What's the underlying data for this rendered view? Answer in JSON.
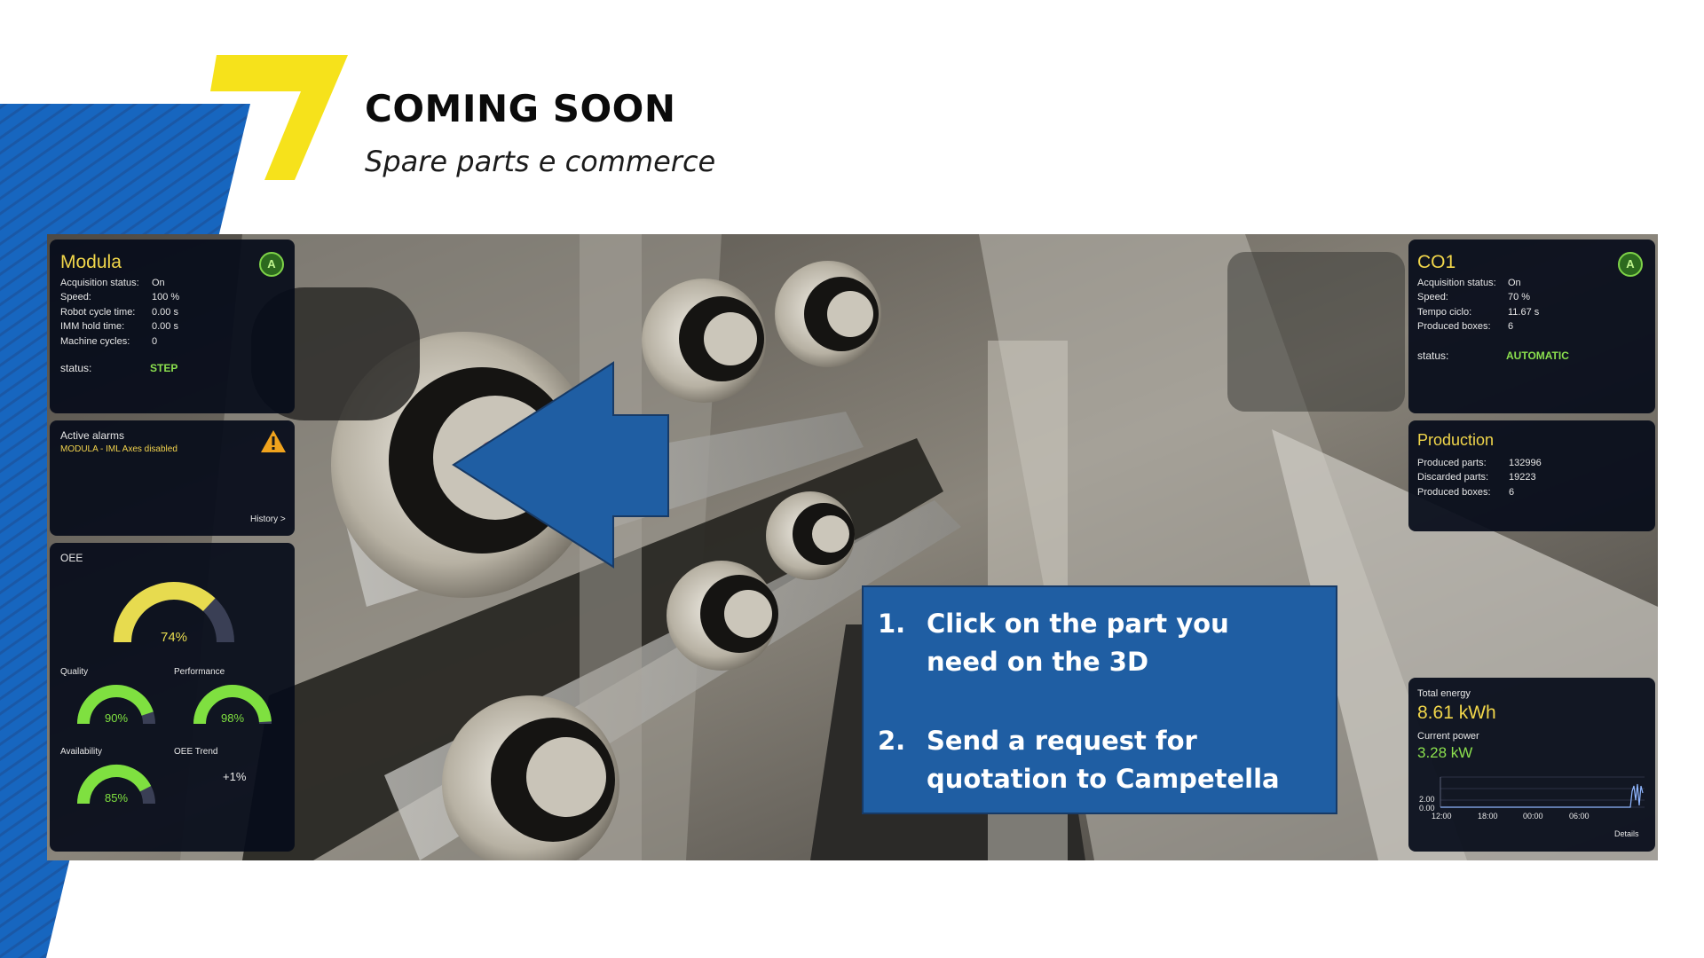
{
  "slide": {
    "title": "COMING SOON",
    "subtitle": "Spare parts e commerce",
    "accent_yellow": "#f6e21b",
    "accent_blue": "#1863b7"
  },
  "callout": {
    "steps": [
      {
        "number": "1.",
        "text": "Click on the part you need on the 3D"
      },
      {
        "number": "2.",
        "text": "Send a request for quotation to Campetella"
      }
    ],
    "fill": "#1f5ea3"
  },
  "modula": {
    "title": "Modula",
    "badge": "A",
    "rows": [
      {
        "label": "Acquisition status:",
        "value": "On"
      },
      {
        "label": "Speed:",
        "value": "100 %"
      },
      {
        "label": "Robot cycle time:",
        "value": "0.00 s"
      },
      {
        "label": "IMM hold time:",
        "value": "0.00 s"
      },
      {
        "label": "Machine cycles:",
        "value": "0"
      }
    ],
    "status_label": "status:",
    "status_value": "STEP"
  },
  "alarms": {
    "title": "Active alarms",
    "message": "MODULA - IML Axes disabled",
    "history_link": "History >",
    "icon": "warning-icon"
  },
  "oee": {
    "title": "OEE",
    "main_value": "74%",
    "main_fraction": 0.74,
    "gauges": [
      {
        "label": "Quality",
        "value": "90%",
        "fraction": 0.9
      },
      {
        "label": "Performance",
        "value": "98%",
        "fraction": 0.98
      },
      {
        "label": "Availability",
        "value": "85%",
        "fraction": 0.85
      }
    ],
    "trend_label": "OEE Trend",
    "trend_value": "+1%",
    "colors": {
      "main": "#e7db4f",
      "green": "#7fe040",
      "track": "#3a3f55"
    }
  },
  "co1": {
    "title": "CO1",
    "badge": "A",
    "rows": [
      {
        "label": "Acquisition status:",
        "value": "On"
      },
      {
        "label": "Speed:",
        "value": "70 %"
      },
      {
        "label": "Tempo ciclo:",
        "value": "11.67 s"
      },
      {
        "label": "Produced boxes:",
        "value": "6"
      }
    ],
    "status_label": "status:",
    "status_value": "AUTOMATIC"
  },
  "production": {
    "title": "Production",
    "rows": [
      {
        "label": "Produced parts:",
        "value": "132996"
      },
      {
        "label": "Discarded parts:",
        "value": "19223"
      },
      {
        "label": "Produced boxes:",
        "value": "6"
      }
    ]
  },
  "energy": {
    "total_label": "Total energy",
    "total_value": "8.61 kWh",
    "power_label": "Current power",
    "power_value": "3.28 kW",
    "details_link": "Details",
    "chart_data": {
      "type": "line",
      "x_ticks": [
        "12:00",
        "18:00",
        "00:00",
        "06:00"
      ],
      "y_ticks": [
        "2.00",
        "0.00"
      ],
      "ylim": [
        0,
        3.5
      ]
    }
  }
}
